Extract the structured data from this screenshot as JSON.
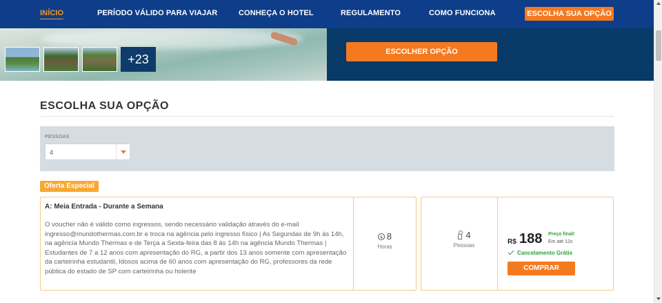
{
  "nav": {
    "items": [
      {
        "label": "INÍCIO",
        "active": true
      },
      {
        "label": "PERÍODO VÁLIDO PARA VIAJAR",
        "active": false
      },
      {
        "label": "CONHEÇA O HOTEL",
        "active": false
      },
      {
        "label": "REGULAMENTO",
        "active": false
      },
      {
        "label": "COMO FUNCIONA",
        "active": false
      }
    ],
    "cta_label": "ESCOLHA SUA OPÇÃO"
  },
  "hero": {
    "more_photos_label": "+23",
    "choose_button_label": "ESCOLHER OPÇÃO"
  },
  "section": {
    "title": "ESCOLHA SUA OPÇÃO"
  },
  "filter": {
    "people_label": "PESSOAS",
    "people_value": "4"
  },
  "offer": {
    "badge": "Oferta Especial",
    "title": "A: Meia Entrada - Durante a Semana",
    "description": "O voucher não é válido como ingressos, sendo necessário validação através do e-mail ingresso@mundothermas.com.br e troca na agência pelo ingresso físico | As Segundas de 9h às 14h, na agência Mundo Thermas e de Terça a Sexta-feira das 8 às 14h na agência Mundo Thermas | Estudantes de 7 a 12 anos com apresentação do RG, a partir dos 13 anos somente com apresentação da carteirinha estudantil, Idosos acima de 60 anos com apresentação do RG, professores da rede pública do estado de SP com carteirinha ou holerite",
    "hours_value": "8",
    "hours_label": "Horas",
    "people_value": "4",
    "people_label": "Pessoas",
    "currency": "R$",
    "price": "188",
    "price_final_label": "Preço final!",
    "installments": "Em até 12x",
    "cancellation": "Cancelamento Grátis",
    "buy_label": "COMPRAR"
  },
  "colors": {
    "nav_bg": "#0e3d8a",
    "accent_orange": "#f47a20",
    "hero_panel": "#083a68",
    "success_green": "#2e9e3e"
  }
}
